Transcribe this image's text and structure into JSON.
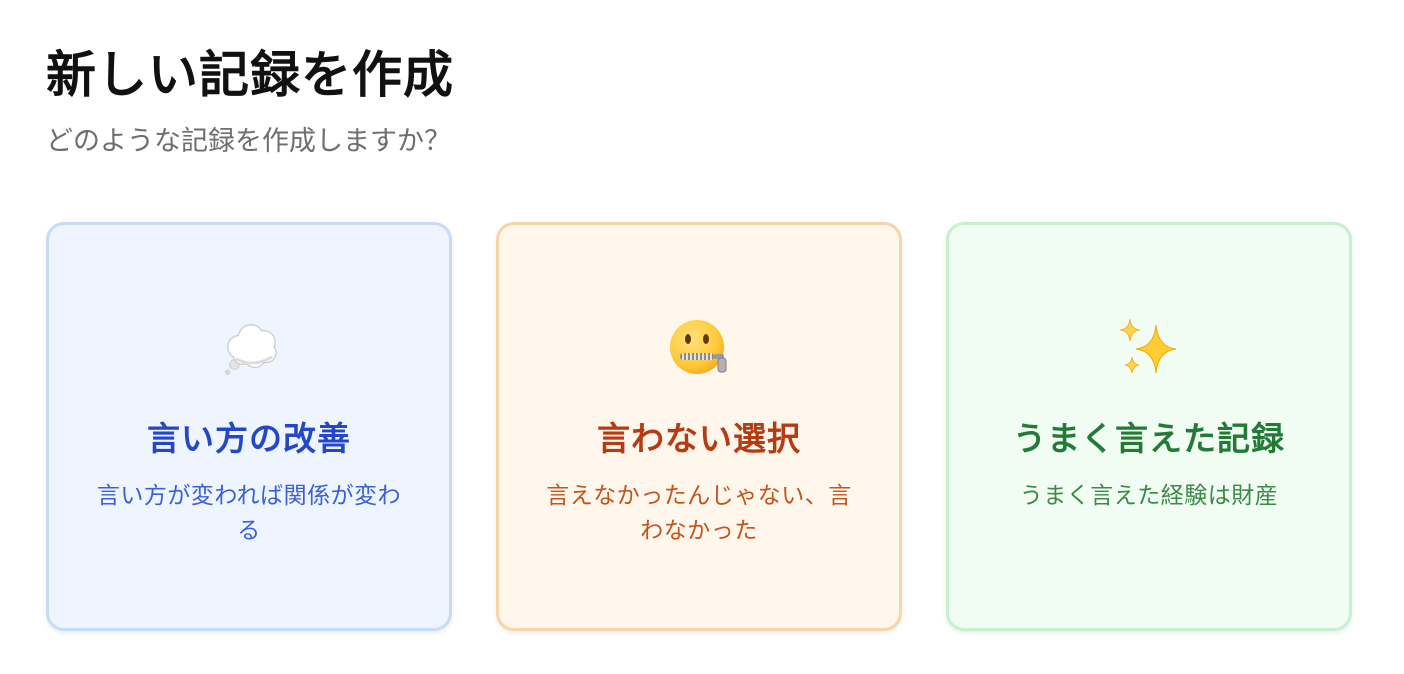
{
  "header": {
    "title": "新しい記録を作成",
    "subtitle": "どのような記録を作成しますか？"
  },
  "cards": [
    {
      "icon": "thought-balloon-icon",
      "title": "言い方の改善",
      "description": "言い方が変われば関係が変わる",
      "accent": "#2446c9"
    },
    {
      "icon": "zipper-mouth-face-icon",
      "title": "言わない選択",
      "description": "言えなかったんじゃない、言わなかった",
      "accent": "#b63b12"
    },
    {
      "icon": "sparkles-icon",
      "title": "うまく言えた記録",
      "description": "うまく言えた経験は財産",
      "accent": "#227a36"
    }
  ]
}
